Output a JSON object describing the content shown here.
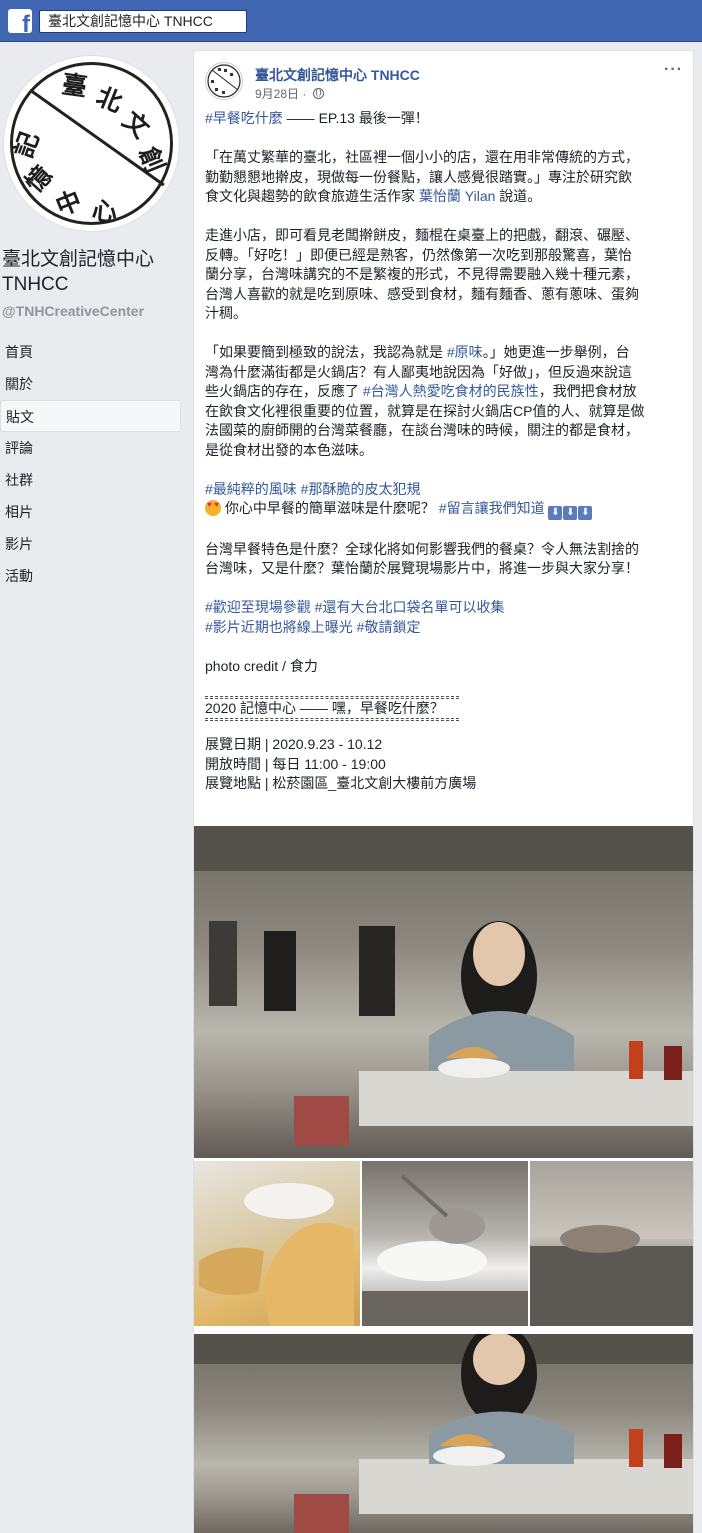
{
  "topbar": {
    "search_value": "臺北文創記憶中心 TNHCC"
  },
  "page": {
    "name": "臺北文創記憶中心 TNHCC",
    "handle": "@TNHCreativeCenter",
    "logo_text": [
      "臺",
      "北",
      "文",
      "創",
      "記",
      "憶",
      "中",
      "心"
    ]
  },
  "nav": {
    "items": [
      {
        "label": "首頁"
      },
      {
        "label": "關於"
      },
      {
        "label": "貼文"
      },
      {
        "label": "評論"
      },
      {
        "label": "社群"
      },
      {
        "label": "相片"
      },
      {
        "label": "影片"
      },
      {
        "label": "活動"
      }
    ],
    "active_index": 2
  },
  "post": {
    "author": "臺北文創記憶中心 TNHCC",
    "date": "9月28日",
    "date_sep": "·",
    "more": "···",
    "intro_tag": "#早餐吃什麼",
    "intro_rest": " —— EP.13 最後一彈！",
    "p1": [
      "「在萬丈繁華的臺北，社區裡一個小小的店，還在用非常傳統的方式，",
      "勤勤懇懇地擀皮，現做每一份餐點，讓人感覺很踏實。」專注於研究飲"
    ],
    "p1_last_pre": "食文化與趨勢的飲食旅遊生活作家 ",
    "p1_link": "葉怡蘭 Yilan",
    "p1_last_post": " 說道。",
    "p2": [
      "走進小店，即可看見老闆擀餅皮，麵棍在桌臺上的把戲，翻滾、碾壓、",
      "反轉。「好吃！」即便已經是熟客，仍然像第一次吃到那般驚喜，葉怡",
      "蘭分享，台灣味講究的不是繁複的形式，不見得需要融入幾十種元素，",
      "台灣人喜歡的就是吃到原味、感受到食材，麵有麵香、蔥有蔥味、蛋夠",
      "汁稠。"
    ],
    "p3_l1_pre": "「如果要簡到極致的說法，我認為就是 ",
    "p3_l1_tag": "#原味",
    "p3_l1_post": "。」她更進一步舉例，台",
    "p3_l2": "灣為什麼滿街都是火鍋店？有人鄙夷地說因為「好做」，但反過來說這",
    "p3_l3_pre": "些火鍋店的存在，反應了 ",
    "p3_l3_tag": "#台灣人熱愛吃食材的民族性",
    "p3_l3_post": "，我們把食材放",
    "p3_rest": [
      "在飲食文化裡很重要的位置，就算是在探討火鍋店CP值的人、就算是做",
      "法國菜的廚師開的台灣菜餐廳，在談台灣味的時候，關注的都是食材，",
      "是從食材出發的本色滋味。"
    ],
    "tags1": "#最純粹的風味 #那酥脆的皮太犯規",
    "q_text": " 你心中早餐的簡單滋味是什麼呢？ ",
    "q_tag": "#留言讓我們知道",
    "q_arrows": [
      "⬇",
      "⬇",
      "⬇"
    ],
    "p5": [
      "台灣早餐特色是什麼？全球化將如何影響我們的餐桌？令人無法割捨的",
      "台灣味，又是什麼？葉怡蘭於展覽現場影片中，將進一步與大家分享！"
    ],
    "tags2": "#歡迎至現場參觀 #還有大台北口袋名單可以收集",
    "tags3": "#影片近期也將線上曝光 #敬請鎖定",
    "credit": "photo credit / 食力",
    "event_title": "2020 記憶中心 —— 嘿，早餐吃什麼？",
    "event_dates": "展覽日期 | 2020.9.23 - 10.12",
    "event_hours": "開放時間 | 每日 11:00 - 19:00",
    "event_place": "展覽地點 | 松菸園區_臺北文創大樓前方廣場"
  }
}
